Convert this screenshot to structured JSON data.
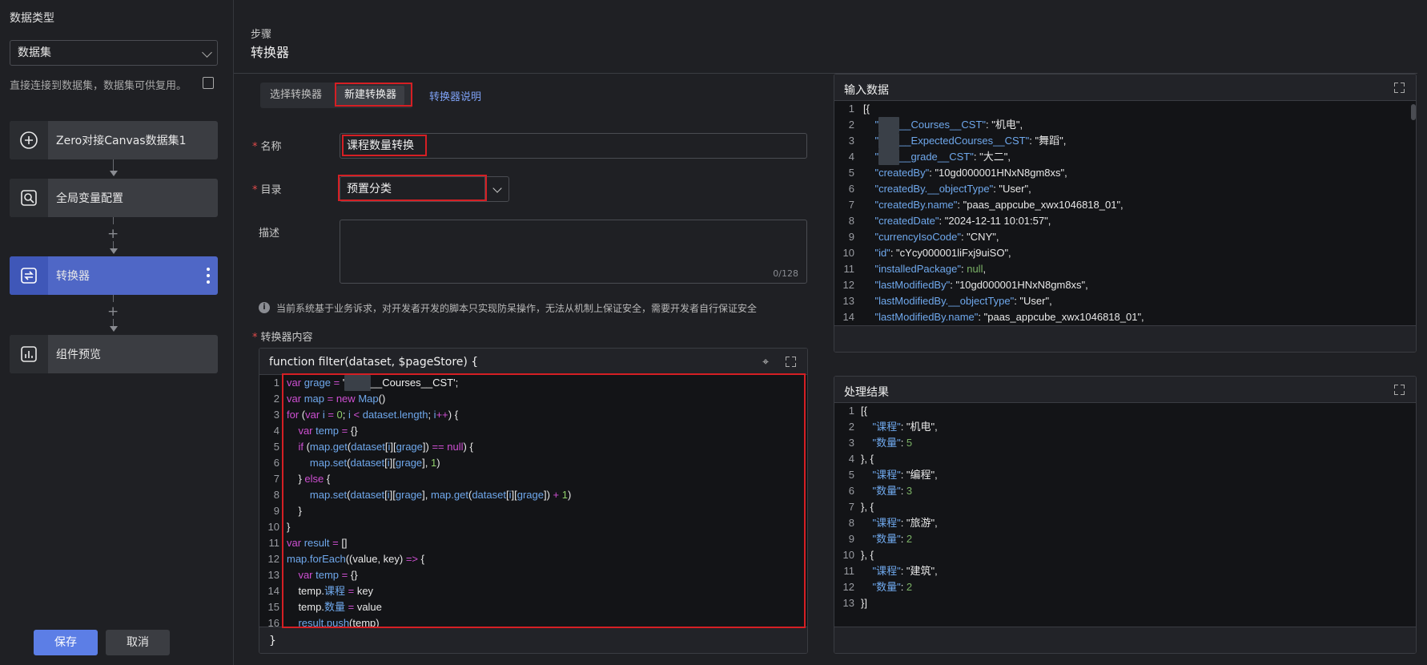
{
  "sidebar": {
    "section_title": "数据类型",
    "select_value": "数据集",
    "hint": "直接连接到数据集，数据集可供复用。",
    "steps": [
      {
        "label": "Zero对接Canvas数据集1",
        "icon": "plus-circle-icon"
      },
      {
        "label": "全局变量配置",
        "icon": "variable-search-icon"
      },
      {
        "label": "转换器",
        "icon": "transform-icon",
        "active": true
      },
      {
        "label": "组件预览",
        "icon": "bar-chart-icon"
      }
    ],
    "save_label": "保存",
    "cancel_label": "取消"
  },
  "header": {
    "step_caption": "步骤",
    "step_name": "转换器"
  },
  "tabs": {
    "select_label": "选择转换器",
    "new_label": "新建转换器",
    "doc_link": "转换器说明"
  },
  "form": {
    "name_label": "名称",
    "name_value": "课程数量转换",
    "dir_label": "目录",
    "dir_value": "预置分类",
    "desc_label": "描述",
    "desc_counter": "0/128",
    "notice": "当前系统基于业务诉求，对开发者开发的脚本只实现防呆操作，无法从机制上保证安全，需要开发者自行保证安全",
    "content_label": "转换器内容"
  },
  "editor": {
    "header": "function filter(dataset, $pageStore) {",
    "footer": "}",
    "line_numbers": [
      "1",
      "2",
      "3",
      "4",
      "5",
      "6",
      "7",
      "8",
      "9",
      "10",
      "11",
      "12",
      "13",
      "14",
      "15",
      "16"
    ]
  },
  "input_panel": {
    "title": "输入数据",
    "line_numbers": [
      "1",
      "2",
      "3",
      "4",
      "5",
      "6",
      "7",
      "8",
      "9",
      "10",
      "11",
      "12",
      "13",
      "14"
    ]
  },
  "output_panel": {
    "title": "处理结果",
    "line_numbers": [
      "1",
      "2",
      "3",
      "4",
      "5",
      "6",
      "7",
      "8",
      "9",
      "10",
      "11",
      "12",
      "13"
    ]
  },
  "colors": {
    "accent": "#4f67c6",
    "primary_button": "#5c7ee6",
    "highlight_border": "#d51f24",
    "link": "#7ea1f5"
  }
}
